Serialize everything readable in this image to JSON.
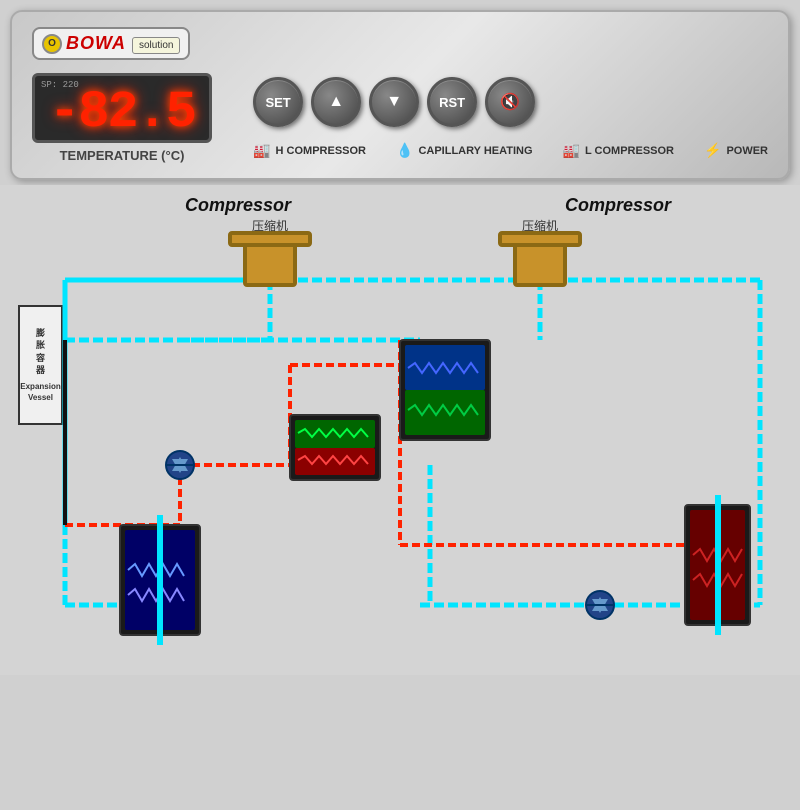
{
  "logo": {
    "circle_text": "O",
    "brand_name": "BOWA",
    "sub_text": "solution"
  },
  "display": {
    "small_label": "SP: 220",
    "temperature": "-82.5",
    "unit_label": "TEMPERATURE (°C)"
  },
  "buttons": {
    "set_label": "SET",
    "up_label": "▲",
    "down_label": "▼",
    "rst_label": "RST",
    "mute_label": "🔇"
  },
  "legend": [
    {
      "id": "h-compressor",
      "icon": "🏭",
      "text": "H COMPRESSOR"
    },
    {
      "id": "capillary",
      "icon": "💧",
      "text": "CAPILLARY HEATING"
    },
    {
      "id": "l-compressor",
      "icon": "🏭",
      "text": "L COMPRESSOR"
    },
    {
      "id": "power",
      "icon": "⚡",
      "text": "POWER"
    }
  ],
  "diagram": {
    "compressor_left_label": "Compressor",
    "compressor_right_label": "Compressor",
    "compressor_left_sub": "压缩机",
    "compressor_right_sub": "压缩机",
    "expansion_vessel_cn": "膨胀容器",
    "expansion_vessel_en": "Expansion Vessel"
  }
}
